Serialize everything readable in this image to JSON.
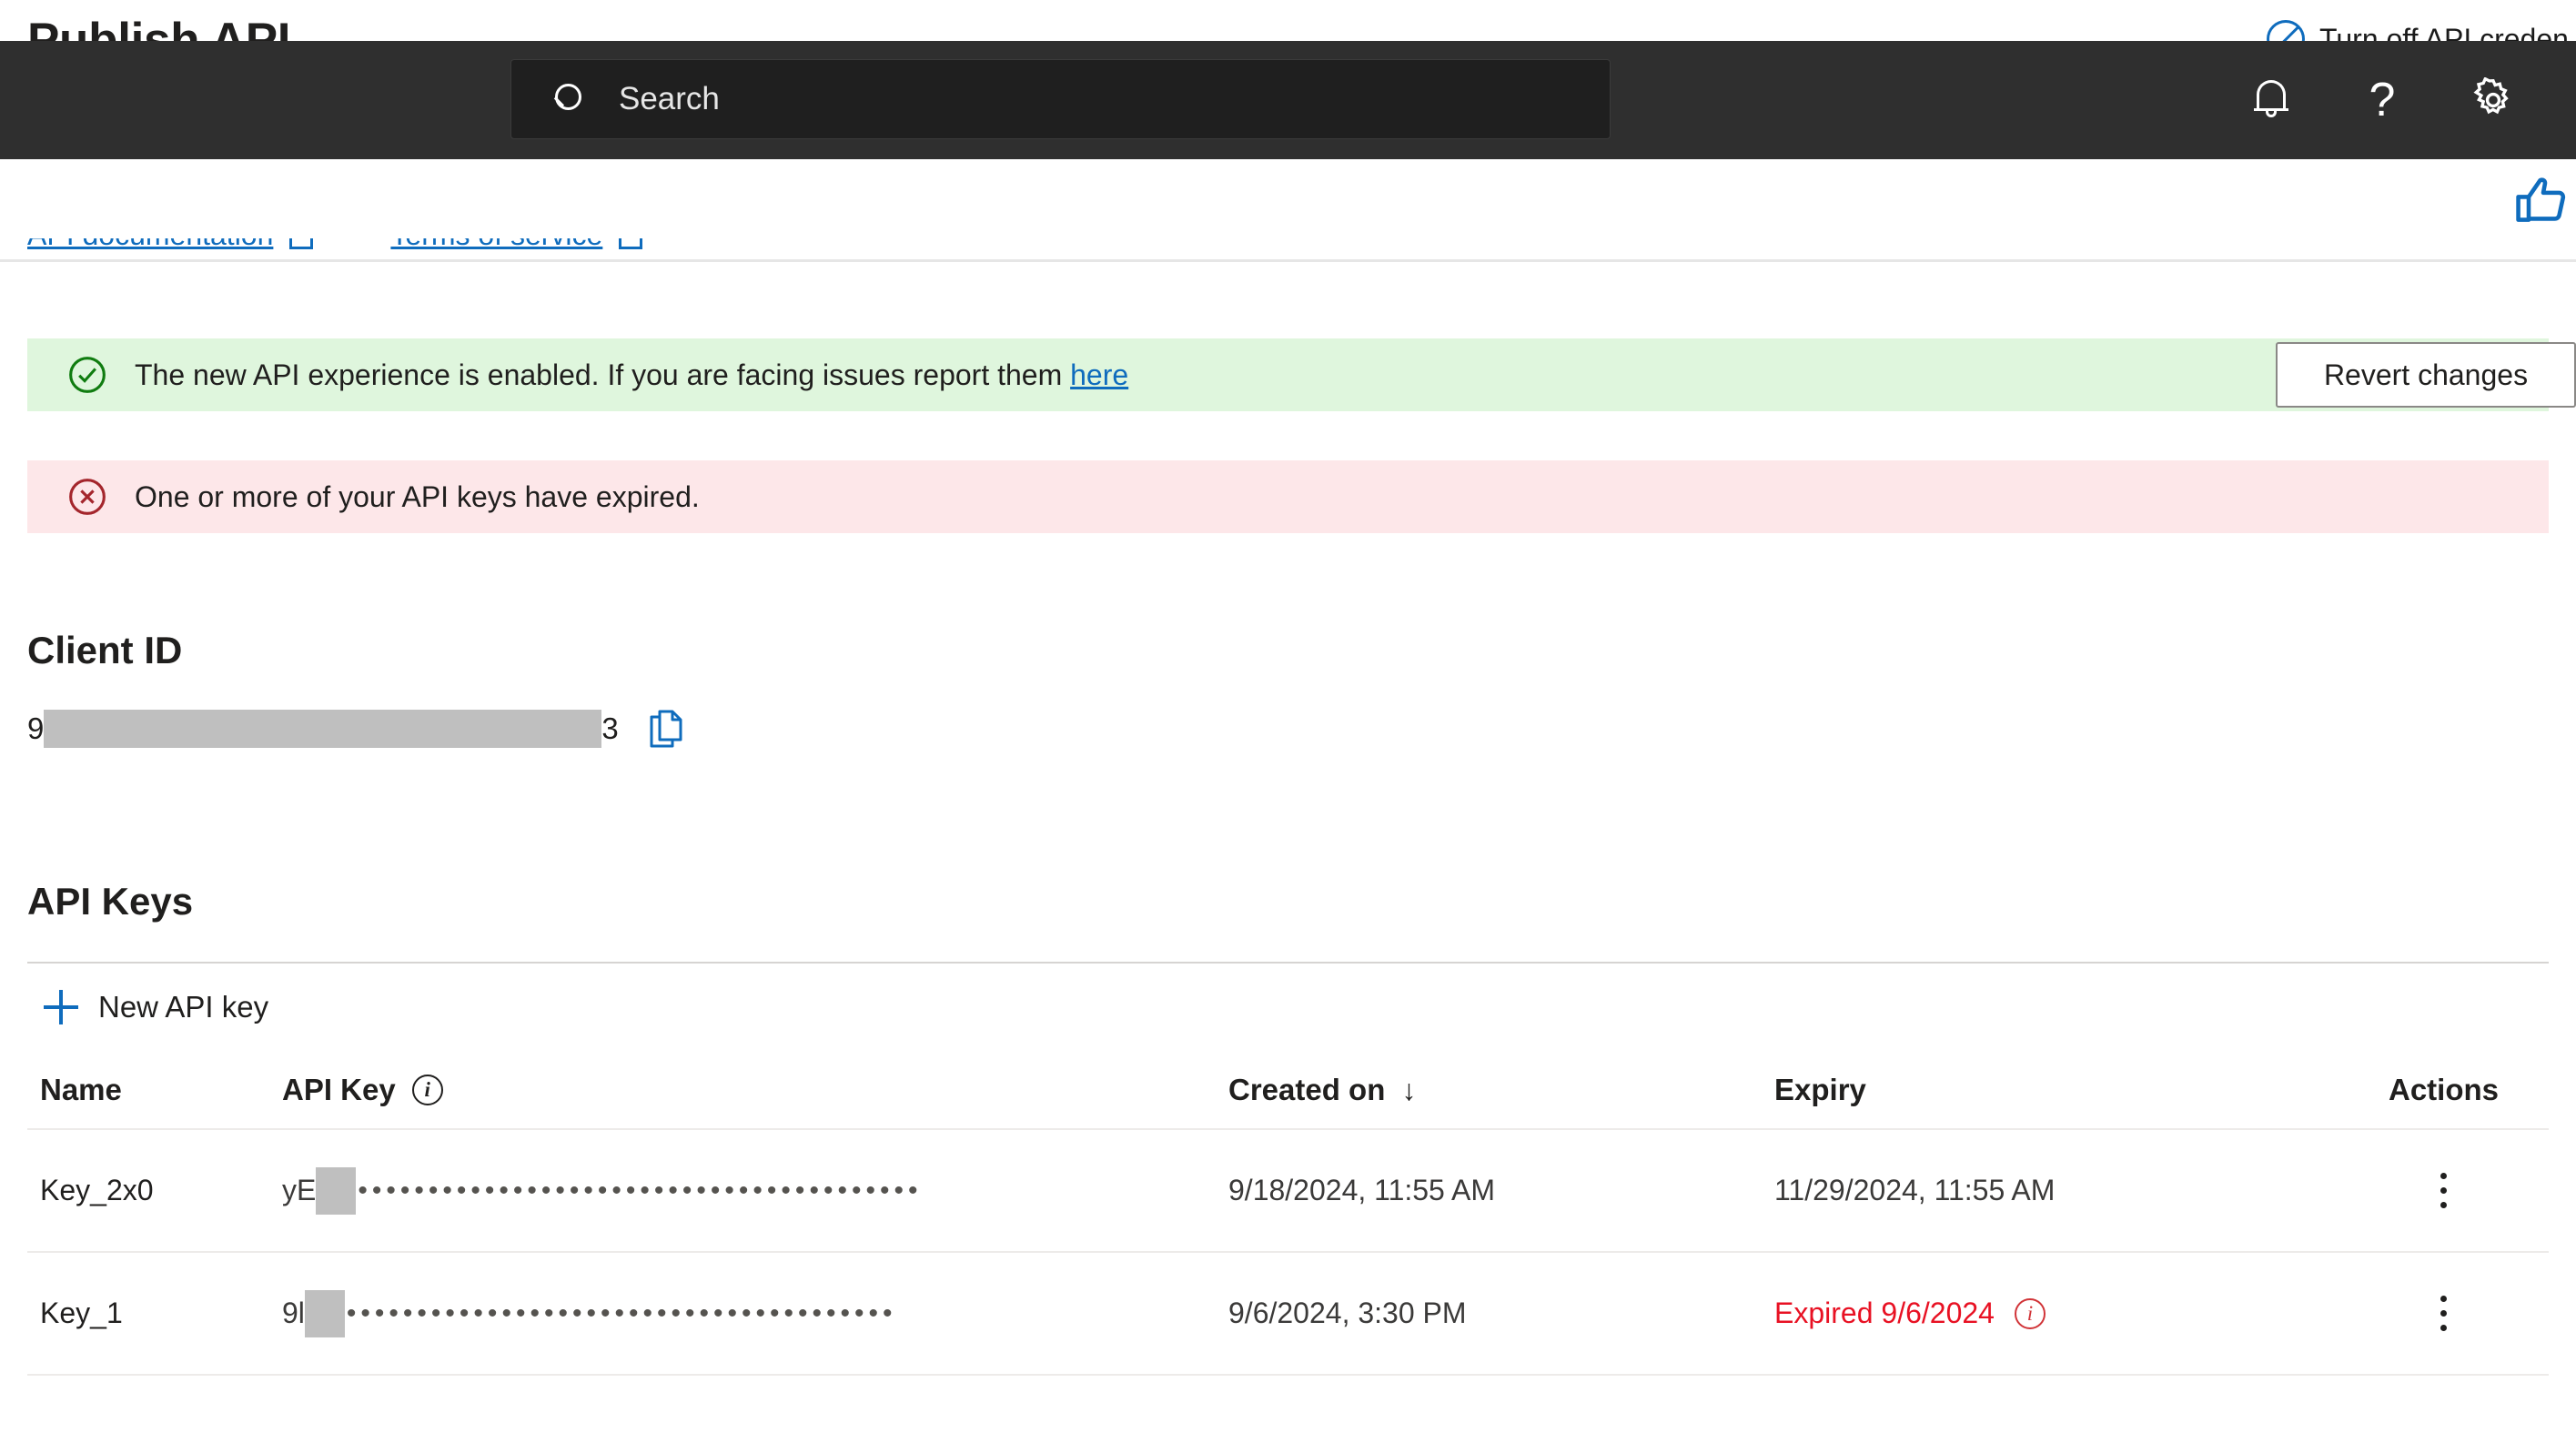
{
  "page": {
    "title": "Publish API",
    "turn_off_label": "Turn off API creden",
    "turn_off_icon": "block-icon",
    "feedback_icon": "thumbs-up-icon"
  },
  "suite_header": {
    "search_placeholder": "Search",
    "search_value": "",
    "search_icon": "search-icon",
    "notifications_icon": "bell-icon",
    "help_icon": "question-mark-icon",
    "settings_icon": "gear-icon",
    "background_color": "#2f2f2f",
    "search_background_color": "#1f1f1f"
  },
  "links": [
    {
      "label": "API documentation",
      "icon": "external-link-icon"
    },
    {
      "label": "Terms of service",
      "icon": "external-link-icon"
    }
  ],
  "messages": {
    "success": {
      "icon": "check-circle-icon",
      "text_before": "The new API experience is enabled. If you are facing issues report them ",
      "link_label": "here",
      "background_color": "#dff6dd",
      "accent_color": "#107c10",
      "action_label": "Revert changes"
    },
    "error": {
      "icon": "error-circle-icon",
      "text": "One or more of your API keys have expired.",
      "background_color": "#fde7e9",
      "accent_color": "#a4262c"
    }
  },
  "client_id": {
    "heading": "Client ID",
    "prefix": "9",
    "suffix": "3",
    "redacted": true,
    "copy_icon": "copy-icon"
  },
  "api_keys": {
    "heading": "API Keys",
    "new_key_label": "New API key",
    "new_key_icon": "plus-icon",
    "columns": [
      {
        "key": "name",
        "label": "Name"
      },
      {
        "key": "apikey",
        "label": "API Key",
        "icon": "info-icon"
      },
      {
        "key": "created",
        "label": "Created on",
        "sort": "↓"
      },
      {
        "key": "expiry",
        "label": "Expiry"
      },
      {
        "key": "actions",
        "label": "Actions"
      }
    ],
    "rows": [
      {
        "name": "Key_2x0",
        "key_prefix": "yE",
        "key_mask": "••••••••••••••••••••••••••••••••••••••••",
        "created": "9/18/2024, 11:55 AM",
        "expiry": "11/29/2024, 11:55 AM",
        "expired": false,
        "actions_icon": "kebab-menu-icon"
      },
      {
        "name": "Key_1",
        "key_prefix": "9l",
        "key_mask": "•••••••••••••••••••••••••••••••••••••••",
        "created": "9/6/2024, 3:30 PM",
        "expiry": "Expired 9/6/2024",
        "expired": true,
        "expiry_icon": "info-icon",
        "actions_icon": "kebab-menu-icon"
      }
    ]
  },
  "colors": {
    "brand_blue": "#0f6cbd",
    "error_red": "#e81123",
    "success_green": "#107c10"
  }
}
